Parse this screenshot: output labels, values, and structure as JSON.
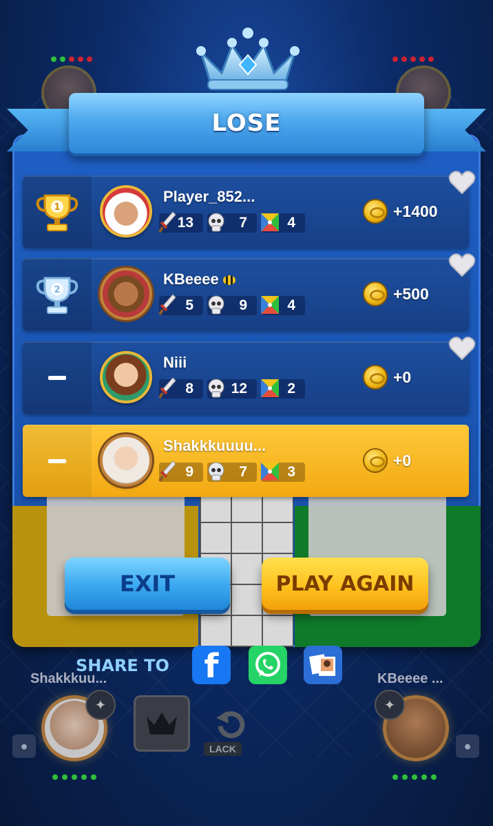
{
  "result_title": "LOSE",
  "players": [
    {
      "rank": 1,
      "rank_icon": "gold-trophy-icon",
      "name": "Player_852...",
      "weapon": "13",
      "kills": "7",
      "board": "4",
      "reward": "+1400",
      "highlight": false,
      "has_heart": true
    },
    {
      "rank": 2,
      "rank_icon": "silver-trophy-icon",
      "name": "KBeeee",
      "name_badge": "bee-icon",
      "weapon": "5",
      "kills": "9",
      "board": "4",
      "reward": "+500",
      "highlight": false,
      "has_heart": true
    },
    {
      "rank": "-",
      "rank_icon": "dash",
      "name": "Niii",
      "weapon": "8",
      "kills": "12",
      "board": "2",
      "reward": "+0",
      "highlight": false,
      "has_heart": true
    },
    {
      "rank": "-",
      "rank_icon": "dash",
      "name": "Shakkkuuuu...",
      "weapon": "9",
      "kills": "7",
      "board": "3",
      "reward": "+0",
      "highlight": true,
      "has_heart": false
    }
  ],
  "buttons": {
    "exit": "EXIT",
    "play_again": "PLAY AGAIN"
  },
  "share": {
    "label": "SHARE TO",
    "targets": [
      "facebook-icon",
      "whatsapp-icon",
      "photos-icon"
    ],
    "fb_glyph": "f"
  },
  "bottom": {
    "left_player": "Shakkkuu...",
    "right_player": "KBeeee ...",
    "lack_label": "LACK"
  },
  "colors": {
    "panel": "#1a54b0",
    "highlight_row": "#ffc83a",
    "exit_button": "#3aa7f0",
    "play_button": "#ffc21f"
  }
}
